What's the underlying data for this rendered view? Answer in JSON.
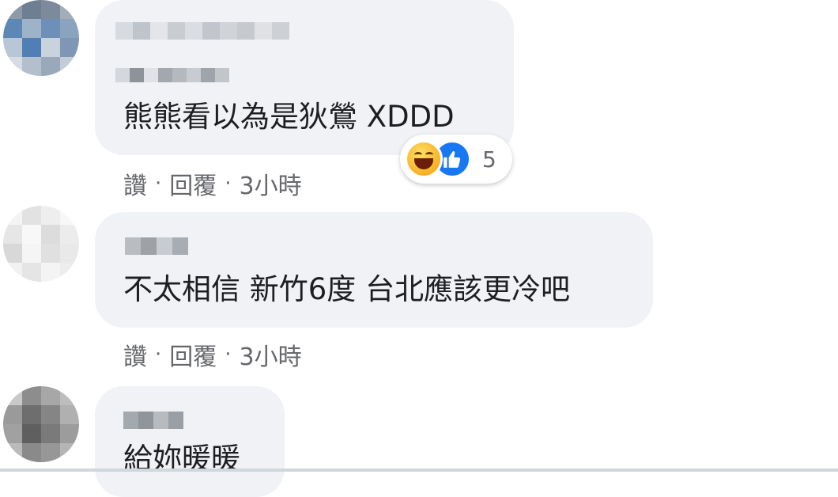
{
  "comments": [
    {
      "text": "熊熊看以為是狄鶯 XDDD",
      "actions": {
        "like": "讚",
        "reply": "回覆",
        "time": "3小時"
      },
      "reactions": {
        "icons": [
          "haha-icon",
          "like-icon"
        ],
        "count": "5"
      }
    },
    {
      "text": "不太相信 新竹6度 台北應該更冷吧",
      "actions": {
        "like": "讚",
        "reply": "回覆",
        "time": "3小時"
      }
    },
    {
      "text": "給妳暖暖"
    }
  ],
  "separator": "·",
  "colors": {
    "bubble": "#f0f2f5",
    "meta_text": "#65676b",
    "like_blue": "#1877f2",
    "haha_yellow": "#f7b125"
  }
}
